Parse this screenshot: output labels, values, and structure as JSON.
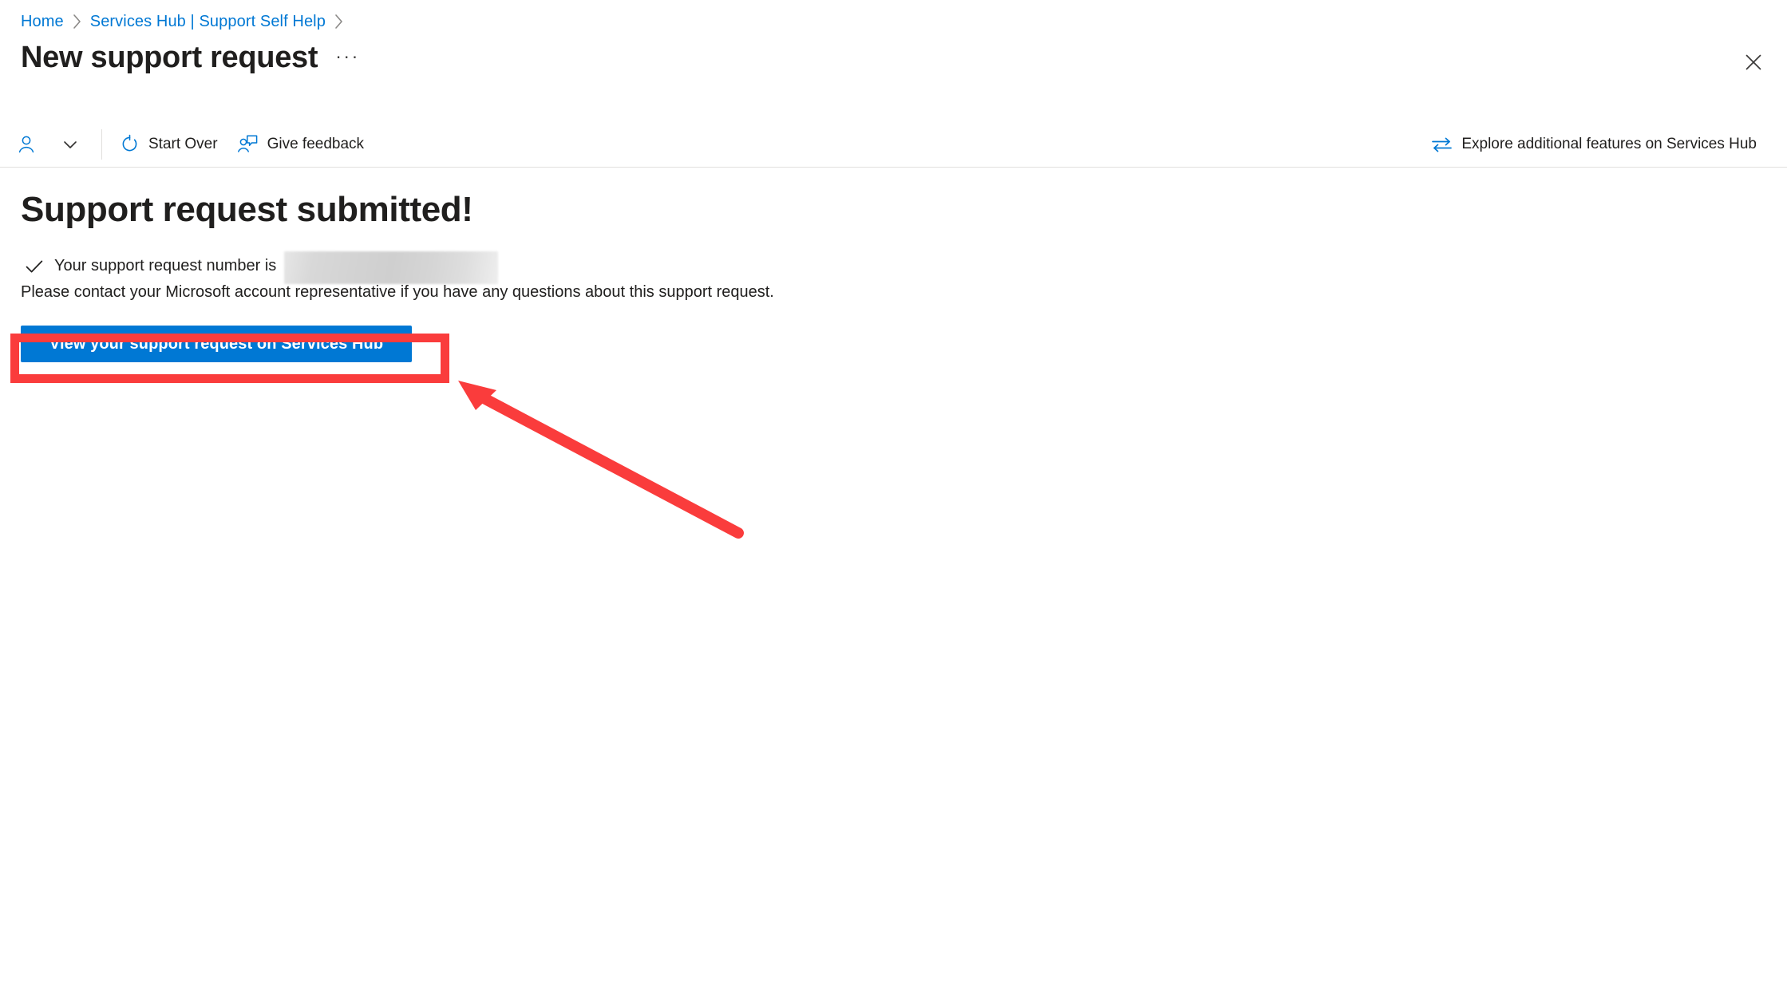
{
  "breadcrumb": {
    "items": [
      {
        "label": "Home",
        "icon": ""
      },
      {
        "label": "Services Hub | Support Self Help",
        "icon": ""
      }
    ],
    "separator_icon": "chevron-right-icon"
  },
  "header": {
    "title": "New support request",
    "ellipsis_label": "···",
    "close_icon": "close-icon"
  },
  "command_bar": {
    "persona": {
      "icon": "person-icon",
      "chevron_icon": "chevron-down-icon"
    },
    "items": [
      {
        "label": "Start Over",
        "icon": "refresh-icon"
      },
      {
        "label": "Give feedback",
        "icon": "feedback-person-icon"
      }
    ],
    "right_item": {
      "label": "Explore additional features on Services Hub",
      "icon": "swap-arrows-icon"
    }
  },
  "main": {
    "heading": "Support request submitted!",
    "status": {
      "icon": "checkmark-icon",
      "text": "Your support request number is",
      "redacted_value": ""
    },
    "paragraph": "Please contact your Microsoft account representative if you have any questions about this support request.",
    "primary_button": "View your support request on Services Hub"
  },
  "annotations": {
    "highlight_color": "#fa3c3c",
    "arrow_color": "#fa3c3c"
  },
  "colors": {
    "accent": "#0078d4",
    "link": "#0078d4",
    "text": "#201f1e",
    "divider": "#e1dfdd"
  }
}
